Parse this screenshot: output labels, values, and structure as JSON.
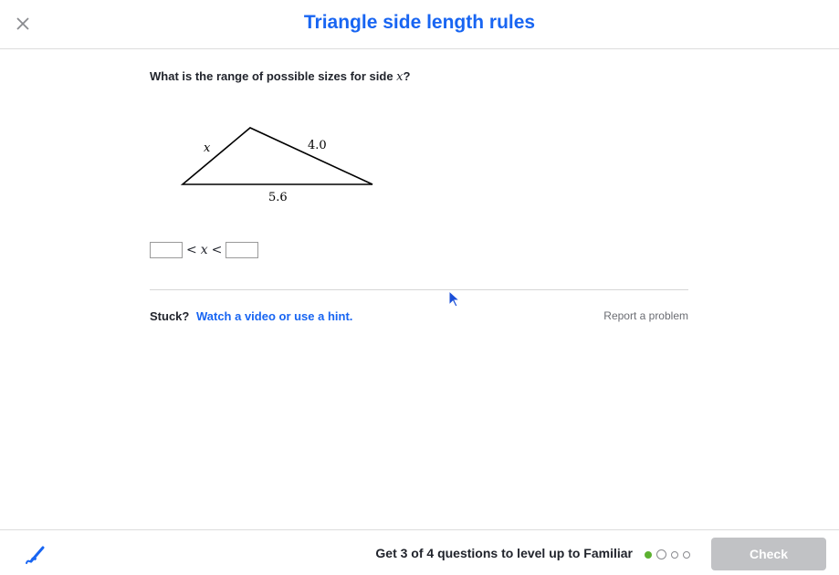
{
  "header": {
    "title": "Triangle side length rules",
    "close_icon": "close-icon"
  },
  "question": {
    "prefix": "What is the range of possible sizes for side ",
    "variable": "x",
    "suffix": "?"
  },
  "diagram": {
    "label_left": "x",
    "label_right": "4.0",
    "label_bottom": "5.6"
  },
  "answer": {
    "lower_value": "",
    "lower_operator": "<",
    "variable": "x",
    "upper_operator": "<",
    "upper_value": ""
  },
  "help": {
    "stuck_label": "Stuck?",
    "hint_link": "Watch a video or use a hint.",
    "report_link": "Report a problem"
  },
  "footer": {
    "scratchpad_icon": "scratchpad-pencil-icon",
    "progress_text": "Get 3 of 4 questions to level up to Familiar",
    "progress_dots": [
      {
        "state": "correct"
      },
      {
        "state": "current"
      },
      {
        "state": "pending"
      },
      {
        "state": "pending"
      }
    ],
    "check_label": "Check"
  },
  "colors": {
    "accent": "#1865f2",
    "correct": "#5cb130",
    "disabled_button": "#c1c2c5"
  }
}
